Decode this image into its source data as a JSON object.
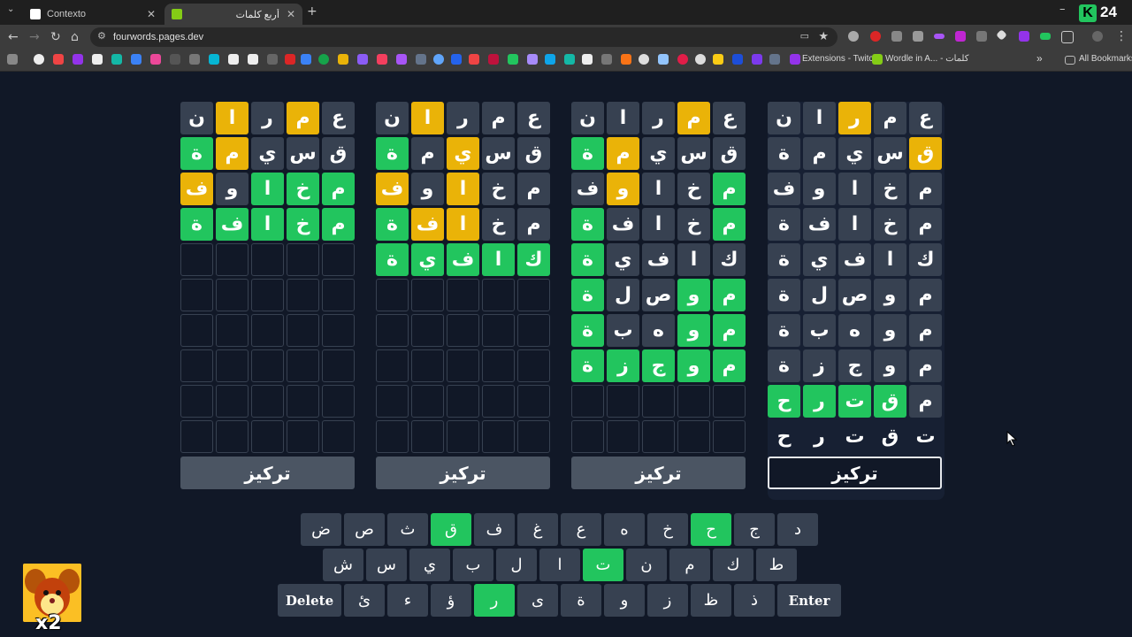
{
  "browser": {
    "tabs": [
      {
        "title": "Contexto",
        "active": false
      },
      {
        "title": "أربع كلمات",
        "active": true
      }
    ],
    "new_tab_label": "+",
    "url": "fourwords.pages.dev",
    "bookmarks": {
      "extensions_twitch": "Extensions - Twitch",
      "wordle_arabic": "Wordle in A... - كلمات",
      "all_bookmarks": "All Bookmarks"
    },
    "corner_logo": "24"
  },
  "colors": {
    "green": "#22c55e",
    "yellow": "#eab308",
    "gray": "#374151",
    "background": "#111827"
  },
  "game": {
    "focus_label": "تركيز",
    "boards": [
      {
        "focused": false,
        "rows": [
          [
            [
              "ن",
              "gray"
            ],
            [
              "ا",
              "yellow"
            ],
            [
              "ر",
              "gray"
            ],
            [
              "م",
              "yellow"
            ],
            [
              "ع",
              "gray"
            ]
          ],
          [
            [
              "ة",
              "green"
            ],
            [
              "م",
              "yellow"
            ],
            [
              "ي",
              "gray"
            ],
            [
              "س",
              "gray"
            ],
            [
              "ق",
              "gray"
            ]
          ],
          [
            [
              "ف",
              "yellow"
            ],
            [
              "و",
              "gray"
            ],
            [
              "ا",
              "green"
            ],
            [
              "خ",
              "green"
            ],
            [
              "م",
              "green"
            ]
          ],
          [
            [
              "ة",
              "green"
            ],
            [
              "ف",
              "green"
            ],
            [
              "ا",
              "green"
            ],
            [
              "خ",
              "green"
            ],
            [
              "م",
              "green"
            ]
          ],
          [
            [
              "",
              "empty"
            ],
            [
              "",
              "empty"
            ],
            [
              "",
              "empty"
            ],
            [
              "",
              "empty"
            ],
            [
              "",
              "empty"
            ]
          ],
          [
            [
              "",
              "empty"
            ],
            [
              "",
              "empty"
            ],
            [
              "",
              "empty"
            ],
            [
              "",
              "empty"
            ],
            [
              "",
              "empty"
            ]
          ],
          [
            [
              "",
              "empty"
            ],
            [
              "",
              "empty"
            ],
            [
              "",
              "empty"
            ],
            [
              "",
              "empty"
            ],
            [
              "",
              "empty"
            ]
          ],
          [
            [
              "",
              "empty"
            ],
            [
              "",
              "empty"
            ],
            [
              "",
              "empty"
            ],
            [
              "",
              "empty"
            ],
            [
              "",
              "empty"
            ]
          ],
          [
            [
              "",
              "empty"
            ],
            [
              "",
              "empty"
            ],
            [
              "",
              "empty"
            ],
            [
              "",
              "empty"
            ],
            [
              "",
              "empty"
            ]
          ],
          [
            [
              "",
              "empty"
            ],
            [
              "",
              "empty"
            ],
            [
              "",
              "empty"
            ],
            [
              "",
              "empty"
            ],
            [
              "",
              "empty"
            ]
          ]
        ]
      },
      {
        "focused": false,
        "rows": [
          [
            [
              "ن",
              "gray"
            ],
            [
              "ا",
              "yellow"
            ],
            [
              "ر",
              "gray"
            ],
            [
              "م",
              "gray"
            ],
            [
              "ع",
              "gray"
            ]
          ],
          [
            [
              "ة",
              "green"
            ],
            [
              "م",
              "gray"
            ],
            [
              "ي",
              "yellow"
            ],
            [
              "س",
              "gray"
            ],
            [
              "ق",
              "gray"
            ]
          ],
          [
            [
              "ف",
              "yellow"
            ],
            [
              "و",
              "gray"
            ],
            [
              "ا",
              "yellow"
            ],
            [
              "خ",
              "gray"
            ],
            [
              "م",
              "gray"
            ]
          ],
          [
            [
              "ة",
              "green"
            ],
            [
              "ف",
              "yellow"
            ],
            [
              "ا",
              "yellow"
            ],
            [
              "خ",
              "gray"
            ],
            [
              "م",
              "gray"
            ]
          ],
          [
            [
              "ة",
              "green"
            ],
            [
              "ي",
              "green"
            ],
            [
              "ف",
              "green"
            ],
            [
              "ا",
              "green"
            ],
            [
              "ك",
              "green"
            ]
          ],
          [
            [
              "",
              "empty"
            ],
            [
              "",
              "empty"
            ],
            [
              "",
              "empty"
            ],
            [
              "",
              "empty"
            ],
            [
              "",
              "empty"
            ]
          ],
          [
            [
              "",
              "empty"
            ],
            [
              "",
              "empty"
            ],
            [
              "",
              "empty"
            ],
            [
              "",
              "empty"
            ],
            [
              "",
              "empty"
            ]
          ],
          [
            [
              "",
              "empty"
            ],
            [
              "",
              "empty"
            ],
            [
              "",
              "empty"
            ],
            [
              "",
              "empty"
            ],
            [
              "",
              "empty"
            ]
          ],
          [
            [
              "",
              "empty"
            ],
            [
              "",
              "empty"
            ],
            [
              "",
              "empty"
            ],
            [
              "",
              "empty"
            ],
            [
              "",
              "empty"
            ]
          ],
          [
            [
              "",
              "empty"
            ],
            [
              "",
              "empty"
            ],
            [
              "",
              "empty"
            ],
            [
              "",
              "empty"
            ],
            [
              "",
              "empty"
            ]
          ]
        ]
      },
      {
        "focused": false,
        "rows": [
          [
            [
              "ن",
              "gray"
            ],
            [
              "ا",
              "gray"
            ],
            [
              "ر",
              "gray"
            ],
            [
              "م",
              "yellow"
            ],
            [
              "ع",
              "gray"
            ]
          ],
          [
            [
              "ة",
              "green"
            ],
            [
              "م",
              "yellow"
            ],
            [
              "ي",
              "gray"
            ],
            [
              "س",
              "gray"
            ],
            [
              "ق",
              "gray"
            ]
          ],
          [
            [
              "ف",
              "gray"
            ],
            [
              "و",
              "yellow"
            ],
            [
              "ا",
              "gray"
            ],
            [
              "خ",
              "gray"
            ],
            [
              "م",
              "green"
            ]
          ],
          [
            [
              "ة",
              "green"
            ],
            [
              "ف",
              "gray"
            ],
            [
              "ا",
              "gray"
            ],
            [
              "خ",
              "gray"
            ],
            [
              "م",
              "green"
            ]
          ],
          [
            [
              "ة",
              "green"
            ],
            [
              "ي",
              "gray"
            ],
            [
              "ف",
              "gray"
            ],
            [
              "ا",
              "gray"
            ],
            [
              "ك",
              "gray"
            ]
          ],
          [
            [
              "ة",
              "green"
            ],
            [
              "ل",
              "gray"
            ],
            [
              "ص",
              "gray"
            ],
            [
              "و",
              "green"
            ],
            [
              "م",
              "green"
            ]
          ],
          [
            [
              "ة",
              "green"
            ],
            [
              "ب",
              "gray"
            ],
            [
              "ه",
              "gray"
            ],
            [
              "و",
              "green"
            ],
            [
              "م",
              "green"
            ]
          ],
          [
            [
              "ة",
              "green"
            ],
            [
              "ز",
              "green"
            ],
            [
              "ج",
              "green"
            ],
            [
              "و",
              "green"
            ],
            [
              "م",
              "green"
            ]
          ],
          [
            [
              "",
              "empty"
            ],
            [
              "",
              "empty"
            ],
            [
              "",
              "empty"
            ],
            [
              "",
              "empty"
            ],
            [
              "",
              "empty"
            ]
          ],
          [
            [
              "",
              "empty"
            ],
            [
              "",
              "empty"
            ],
            [
              "",
              "empty"
            ],
            [
              "",
              "empty"
            ],
            [
              "",
              "empty"
            ]
          ]
        ]
      },
      {
        "focused": true,
        "rows": [
          [
            [
              "ن",
              "gray"
            ],
            [
              "ا",
              "gray"
            ],
            [
              "ر",
              "yellow"
            ],
            [
              "م",
              "gray"
            ],
            [
              "ع",
              "gray"
            ]
          ],
          [
            [
              "ة",
              "gray"
            ],
            [
              "م",
              "gray"
            ],
            [
              "ي",
              "gray"
            ],
            [
              "س",
              "gray"
            ],
            [
              "ق",
              "yellow"
            ]
          ],
          [
            [
              "ف",
              "gray"
            ],
            [
              "و",
              "gray"
            ],
            [
              "ا",
              "gray"
            ],
            [
              "خ",
              "gray"
            ],
            [
              "م",
              "gray"
            ]
          ],
          [
            [
              "ة",
              "gray"
            ],
            [
              "ف",
              "gray"
            ],
            [
              "ا",
              "gray"
            ],
            [
              "خ",
              "gray"
            ],
            [
              "م",
              "gray"
            ]
          ],
          [
            [
              "ة",
              "gray"
            ],
            [
              "ي",
              "gray"
            ],
            [
              "ف",
              "gray"
            ],
            [
              "ا",
              "gray"
            ],
            [
              "ك",
              "gray"
            ]
          ],
          [
            [
              "ة",
              "gray"
            ],
            [
              "ل",
              "gray"
            ],
            [
              "ص",
              "gray"
            ],
            [
              "و",
              "gray"
            ],
            [
              "م",
              "gray"
            ]
          ],
          [
            [
              "ة",
              "gray"
            ],
            [
              "ب",
              "gray"
            ],
            [
              "ه",
              "gray"
            ],
            [
              "و",
              "gray"
            ],
            [
              "م",
              "gray"
            ]
          ],
          [
            [
              "ة",
              "gray"
            ],
            [
              "ز",
              "gray"
            ],
            [
              "ج",
              "gray"
            ],
            [
              "و",
              "gray"
            ],
            [
              "م",
              "gray"
            ]
          ],
          [
            [
              "ح",
              "green"
            ],
            [
              "ر",
              "green"
            ],
            [
              "ت",
              "green"
            ],
            [
              "ق",
              "green"
            ],
            [
              "م",
              "gray"
            ]
          ],
          [
            [
              "ح",
              "plain"
            ],
            [
              "ر",
              "plain"
            ],
            [
              "ت",
              "plain"
            ],
            [
              "ق",
              "plain"
            ],
            [
              "ت",
              "plain"
            ]
          ]
        ]
      }
    ]
  },
  "keyboard": {
    "rows": [
      [
        [
          "ض",
          "gray"
        ],
        [
          "ص",
          "gray"
        ],
        [
          "ث",
          "gray"
        ],
        [
          "ق",
          "green"
        ],
        [
          "ف",
          "gray"
        ],
        [
          "غ",
          "gray"
        ],
        [
          "ع",
          "gray"
        ],
        [
          "ه",
          "gray"
        ],
        [
          "خ",
          "gray"
        ],
        [
          "ح",
          "green"
        ],
        [
          "ج",
          "gray"
        ],
        [
          "د",
          "gray"
        ]
      ],
      [
        [
          "ش",
          "gray"
        ],
        [
          "س",
          "gray"
        ],
        [
          "ي",
          "gray"
        ],
        [
          "ب",
          "gray"
        ],
        [
          "ل",
          "gray"
        ],
        [
          "ا",
          "gray"
        ],
        [
          "ت",
          "green"
        ],
        [
          "ن",
          "gray"
        ],
        [
          "م",
          "gray"
        ],
        [
          "ك",
          "gray"
        ],
        [
          "ط",
          "gray"
        ]
      ],
      [
        [
          "Delete",
          "wide"
        ],
        [
          "ئ",
          "gray"
        ],
        [
          "ء",
          "gray"
        ],
        [
          "ؤ",
          "gray"
        ],
        [
          "ر",
          "green"
        ],
        [
          "ى",
          "gray"
        ],
        [
          "ة",
          "gray"
        ],
        [
          "و",
          "gray"
        ],
        [
          "ز",
          "gray"
        ],
        [
          "ظ",
          "gray"
        ],
        [
          "ذ",
          "gray"
        ],
        [
          "Enter",
          "wide"
        ]
      ]
    ]
  },
  "overlay": {
    "multiplier": "x2"
  }
}
